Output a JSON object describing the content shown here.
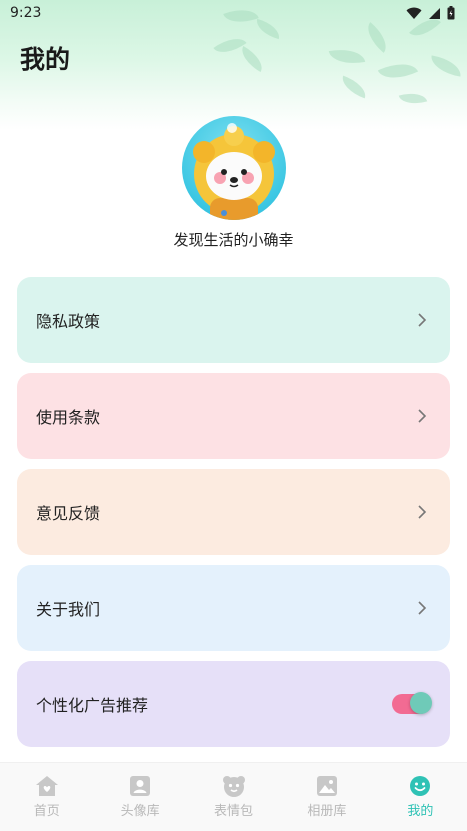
{
  "status_bar": {
    "time": "9:23"
  },
  "header": {
    "title": "我的"
  },
  "profile": {
    "nickname": "发现生活的小确幸"
  },
  "menu": [
    {
      "label": "隐私政策",
      "bg": "#daf4ee",
      "control": "chevron"
    },
    {
      "label": "使用条款",
      "bg": "#fde1e4",
      "control": "chevron"
    },
    {
      "label": "意见反馈",
      "bg": "#fcebe0",
      "control": "chevron"
    },
    {
      "label": "关于我们",
      "bg": "#e4f1fc",
      "control": "chevron"
    },
    {
      "label": "个性化广告推荐",
      "bg": "#e6e0f8",
      "control": "toggle",
      "toggle_on": true
    }
  ],
  "tabbar": {
    "items": [
      {
        "label": "首页",
        "icon": "home-icon"
      },
      {
        "label": "头像库",
        "icon": "portrait-icon"
      },
      {
        "label": "表情包",
        "icon": "emoji-pack-icon"
      },
      {
        "label": "相册库",
        "icon": "photo-album-icon"
      },
      {
        "label": "我的",
        "icon": "smile-icon",
        "active": true
      }
    ],
    "active_color": "#2fc2b5",
    "inactive_color": "#c8c8c8"
  }
}
